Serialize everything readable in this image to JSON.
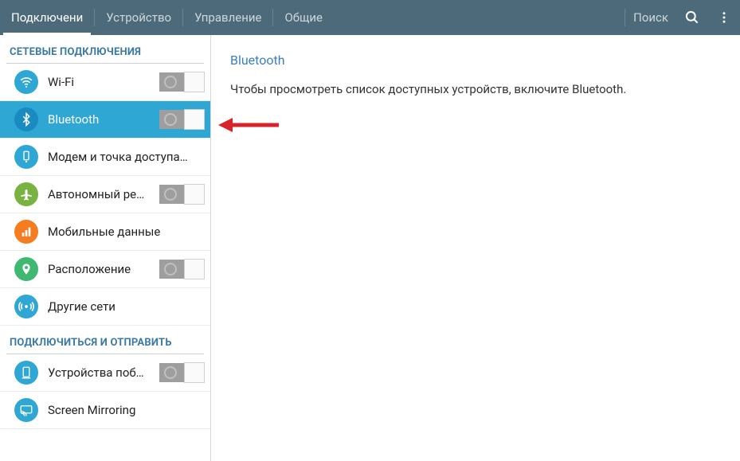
{
  "header": {
    "tabs": [
      {
        "label": "Подключени",
        "active": true
      },
      {
        "label": "Устройство",
        "active": false
      },
      {
        "label": "Управление",
        "active": false
      },
      {
        "label": "Общие",
        "active": false
      }
    ],
    "search_label": "Поиск"
  },
  "sidebar": {
    "sections": [
      {
        "title": "СЕТЕВЫЕ ПОДКЛЮЧЕНИЯ",
        "items": [
          {
            "id": "wifi",
            "label": "Wi-Fi",
            "icon": "wifi-icon",
            "icon_bg": "#2fa7d4",
            "has_toggle": true,
            "selected": false
          },
          {
            "id": "bluetooth",
            "label": "Bluetooth",
            "icon": "bluetooth-icon",
            "icon_bg": "#2fa7d4",
            "has_toggle": true,
            "selected": true
          },
          {
            "id": "tethering",
            "label": "Модем и точка доступа…",
            "icon": "tethering-icon",
            "icon_bg": "#2fa7d4",
            "has_toggle": false,
            "selected": false
          },
          {
            "id": "airplane",
            "label": "Автономный ре…",
            "icon": "airplane-icon",
            "icon_bg": "#78b342",
            "has_toggle": true,
            "selected": false
          },
          {
            "id": "mobiledata",
            "label": "Мобильные данные",
            "icon": "mobile-data-icon",
            "icon_bg": "#f57c1f",
            "has_toggle": false,
            "selected": false
          },
          {
            "id": "location",
            "label": "Расположение",
            "icon": "location-icon",
            "icon_bg": "#3fb971",
            "has_toggle": true,
            "selected": false
          },
          {
            "id": "othernet",
            "label": "Другие сети",
            "icon": "other-networks-icon",
            "icon_bg": "#2fa7d4",
            "has_toggle": false,
            "selected": false
          }
        ]
      },
      {
        "title": "ПОДКЛЮЧИТЬСЯ И ОТПРАВИТЬ",
        "items": [
          {
            "id": "nearby",
            "label": "Устройства поб…",
            "icon": "nearby-devices-icon",
            "icon_bg": "#2fa7d4",
            "has_toggle": true,
            "selected": false
          },
          {
            "id": "screenmirror",
            "label": "Screen Mirroring",
            "icon": "screen-mirroring-icon",
            "icon_bg": "#2fa7d4",
            "has_toggle": false,
            "selected": false
          }
        ]
      }
    ]
  },
  "content": {
    "title": "Bluetooth",
    "message": "Чтобы просмотреть список доступных устройств, включите Bluetooth."
  },
  "colors": {
    "header_bg": "#4d6a7a",
    "selected_bg": "#2fa7d4",
    "section_title": "#3b7aa5",
    "arrow": "#d8232a"
  }
}
